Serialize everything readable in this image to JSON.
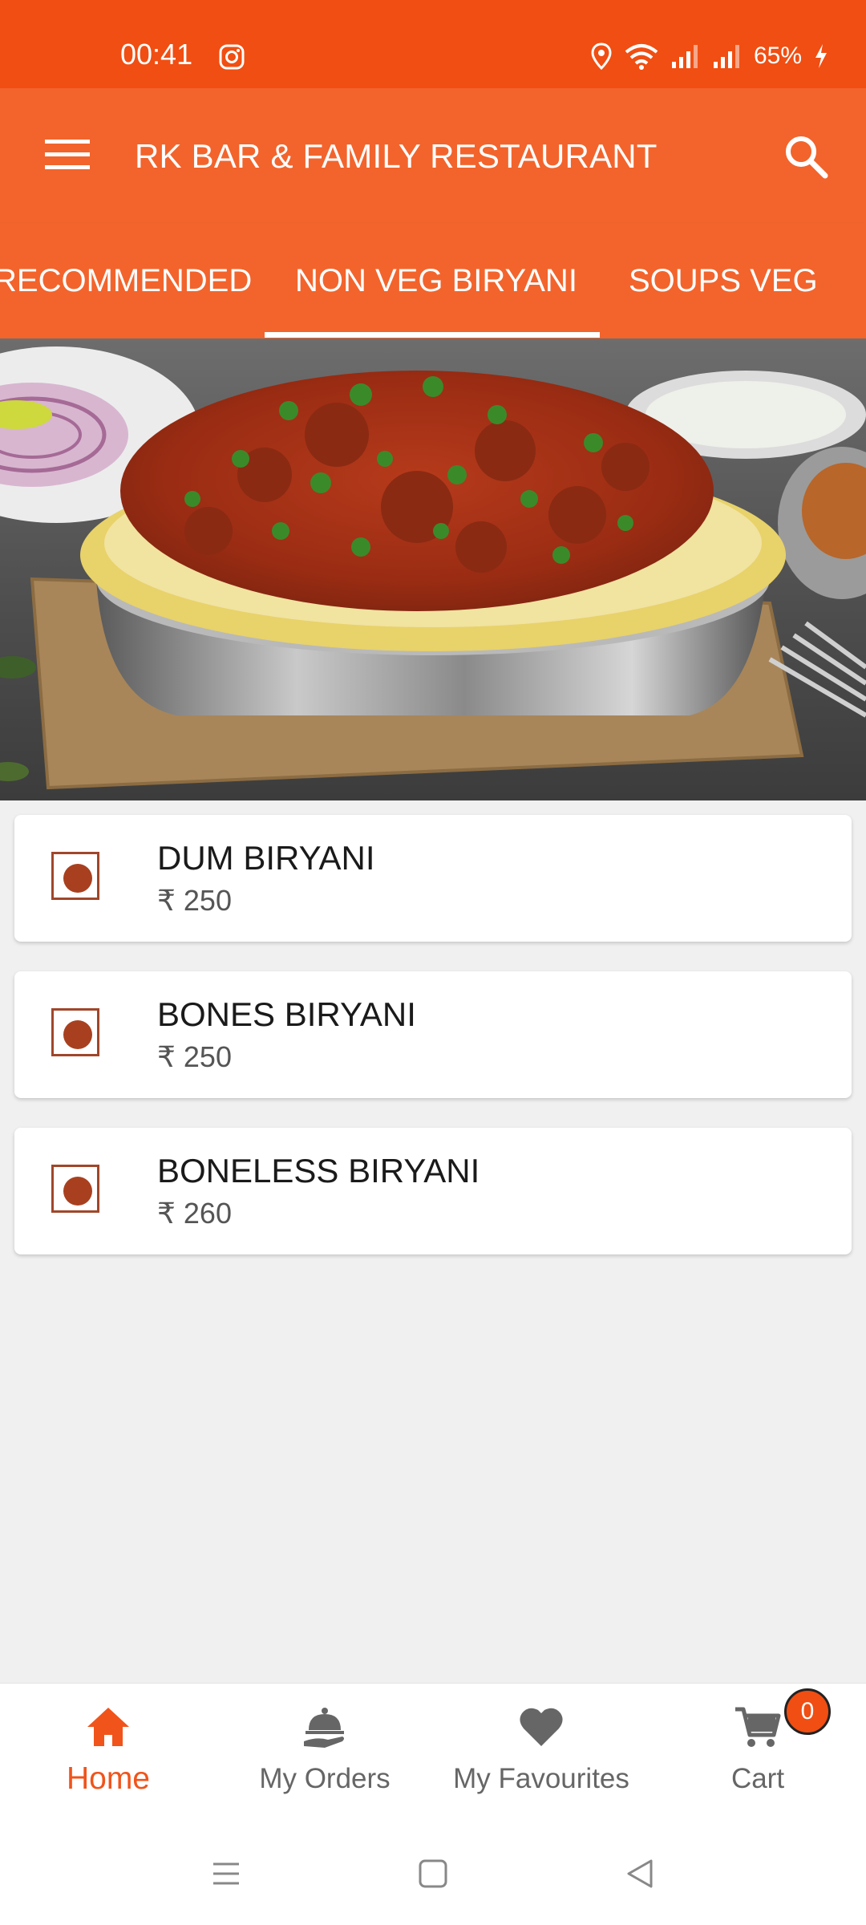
{
  "status_bar": {
    "time": "00:41",
    "battery": "65%",
    "icons": [
      "instagram-icon",
      "location-icon",
      "wifi-icon",
      "signal-icon",
      "signal-icon",
      "charging-icon"
    ]
  },
  "app_bar": {
    "title": "RK BAR & FAMILY RESTAURANT",
    "menu_icon": "hamburger-menu-icon",
    "search_icon": "search-icon"
  },
  "tabs": [
    {
      "label": "RECOMMENDED",
      "selected": false
    },
    {
      "label": "NON VEG BIRYANI",
      "selected": true
    },
    {
      "label": "SOUPS VEG",
      "selected": false
    }
  ],
  "menu_items": [
    {
      "name": "DUM BIRYANI",
      "price": "₹ 250",
      "type": "non-veg"
    },
    {
      "name": "BONES BIRYANI",
      "price": "₹ 250",
      "type": "non-veg"
    },
    {
      "name": "BONELESS BIRYANI",
      "price": "₹ 260",
      "type": "non-veg"
    }
  ],
  "bottom_nav": {
    "items": [
      {
        "label": "Home",
        "icon": "home-icon",
        "active": true
      },
      {
        "label": "My Orders",
        "icon": "serving-dish-icon",
        "active": false
      },
      {
        "label": "My Favourites",
        "icon": "heart-icon",
        "active": false
      },
      {
        "label": "Cart",
        "icon": "cart-icon",
        "active": false
      }
    ],
    "cart_count": "0"
  },
  "colors": {
    "status_bar": "#f04e12",
    "app_bar": "#f2642c",
    "active_nav": "#f0541b",
    "nonveg_marker": "#a8401f",
    "background": "#f0f0f0"
  }
}
